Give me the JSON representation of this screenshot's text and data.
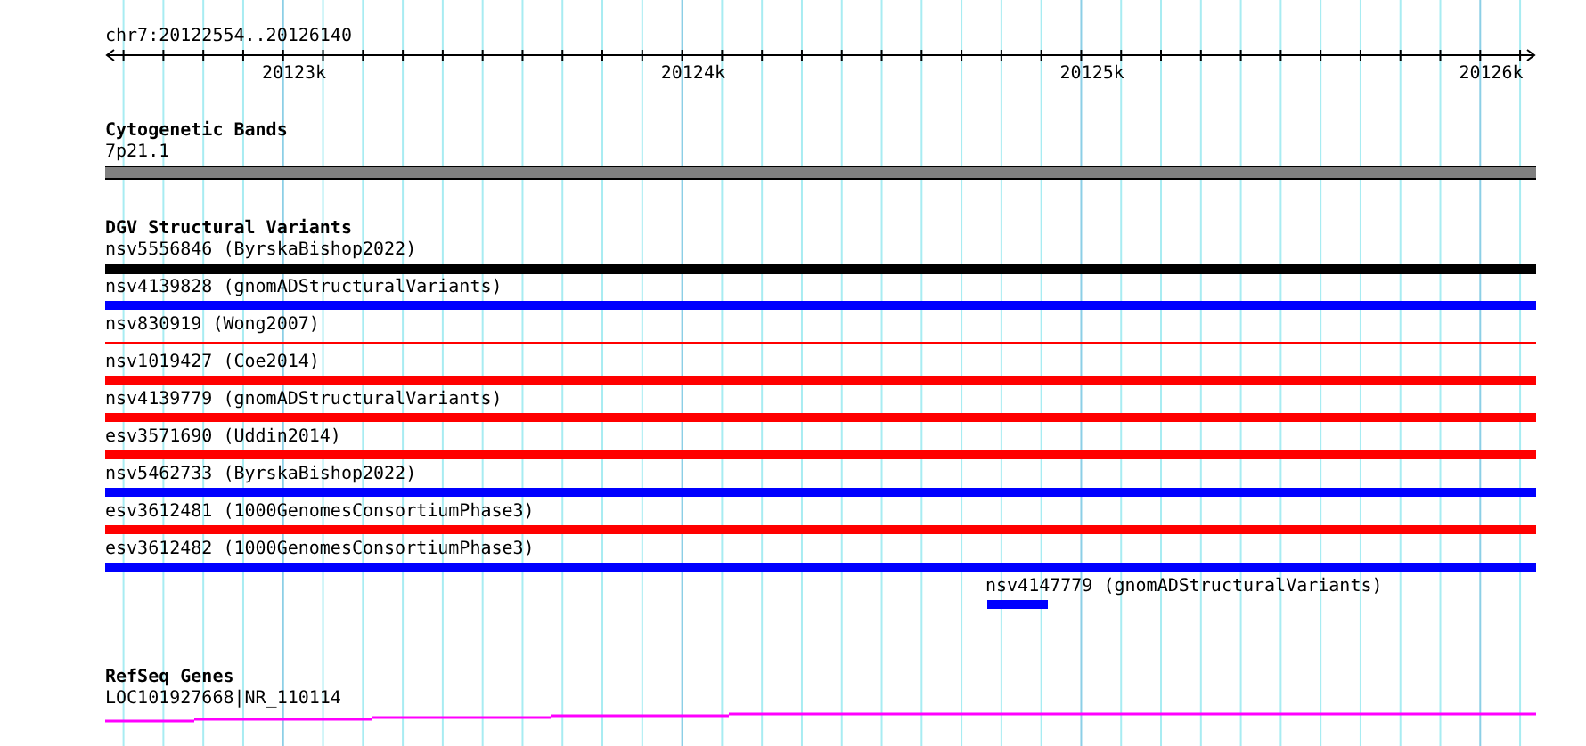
{
  "ruler": {
    "location": "chr7:20122554..20126140",
    "tick_labels": [
      "20123k",
      "20124k",
      "20125k",
      "20126k"
    ]
  },
  "tracks": [
    {
      "kind": "band",
      "title": "Cytogenetic Bands",
      "features": [
        {
          "label": "7p21.1",
          "kind": "band",
          "color": "#808080"
        }
      ]
    },
    {
      "kind": "variants",
      "title": "DGV Structural Variants",
      "features": [
        {
          "label": "nsv5556846 (ByrskaBishop2022)",
          "kind": "thick",
          "color": "#000000"
        },
        {
          "label": "nsv4139828 (gnomADStructuralVariants)",
          "kind": "bar",
          "color": "#0000ff"
        },
        {
          "label": "nsv830919 (Wong2007)",
          "kind": "line",
          "color": "#ff0000"
        },
        {
          "label": "nsv1019427 (Coe2014)",
          "kind": "bar",
          "color": "#ff0000"
        },
        {
          "label": "nsv4139779 (gnomADStructuralVariants)",
          "kind": "bar",
          "color": "#ff0000"
        },
        {
          "label": "esv3571690 (Uddin2014)",
          "kind": "bar",
          "color": "#ff0000"
        },
        {
          "label": "nsv5462733 (ByrskaBishop2022)",
          "kind": "bar",
          "color": "#0000ff"
        },
        {
          "label": "esv3612481 (1000GenomesConsortiumPhase3)",
          "kind": "bar",
          "color": "#ff0000"
        },
        {
          "label": "esv3612482 (1000GenomesConsortiumPhase3)",
          "kind": "bar",
          "color": "#0000ff"
        },
        {
          "label": "nsv4147779 (gnomADStructuralVariants)",
          "kind": "short",
          "color": "#0000ff"
        }
      ]
    },
    {
      "kind": "genes",
      "title": "RefSeq Genes",
      "features": [
        {
          "label": "LOC101927668|NR_110114",
          "kind": "gene",
          "color": "#ff00ff"
        }
      ]
    }
  ]
}
